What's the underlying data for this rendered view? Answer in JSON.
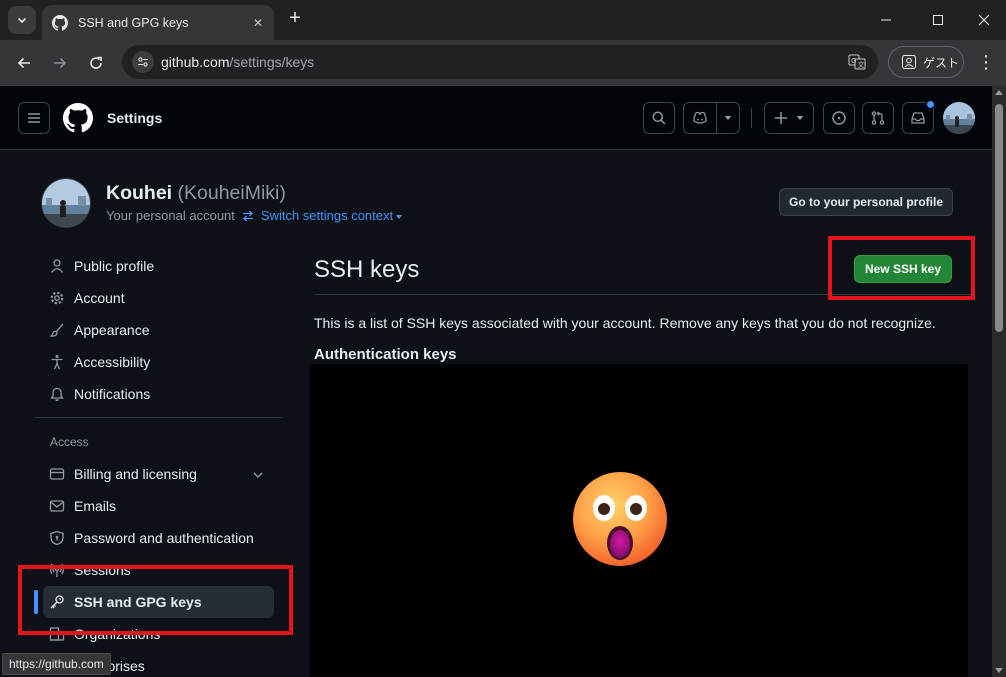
{
  "browser": {
    "tab_title": "SSH and GPG keys",
    "url_host": "github.com",
    "url_path": "/settings/keys",
    "profile_label": "ゲスト",
    "status_url": "https://github.com",
    "icons": [
      "tab-search-icon",
      "github-favicon-icon",
      "close-icon",
      "plus-icon",
      "minimize-icon",
      "maximize-icon",
      "window-close-icon",
      "back-icon",
      "forward-icon",
      "reload-icon",
      "site-info-icon",
      "translate-icon",
      "person-icon",
      "kebab-menu-icon"
    ]
  },
  "header": {
    "context": "Settings",
    "icons": [
      "hamburger-icon",
      "github-logo-icon",
      "search-icon",
      "copilot-icon",
      "caret-down-icon",
      "plus-icon",
      "issue-opened-icon",
      "pull-request-icon",
      "inbox-icon"
    ]
  },
  "account": {
    "name": "Kouhei",
    "login": "(KouheiMiki)",
    "subtitle": "Your personal account",
    "switch_label": "Switch settings context",
    "profile_button": "Go to your personal profile"
  },
  "sidebar": {
    "items": [
      {
        "label": "Public profile",
        "icon": "person-icon"
      },
      {
        "label": "Account",
        "icon": "gear-icon"
      },
      {
        "label": "Appearance",
        "icon": "paintbrush-icon"
      },
      {
        "label": "Accessibility",
        "icon": "accessibility-icon"
      },
      {
        "label": "Notifications",
        "icon": "bell-icon"
      }
    ],
    "access_heading": "Access",
    "access_items": [
      {
        "label": "Billing and licensing",
        "icon": "credit-card-icon"
      },
      {
        "label": "Emails",
        "icon": "mail-icon"
      },
      {
        "label": "Password and authentication",
        "icon": "shield-lock-icon"
      },
      {
        "label": "Sessions",
        "icon": "broadcast-icon"
      },
      {
        "label": "SSH and GPG keys",
        "icon": "key-icon",
        "active": true
      },
      {
        "label": "Organizations",
        "icon": "organization-icon"
      },
      {
        "label": "Enterprises",
        "icon": "globe-icon"
      }
    ]
  },
  "main": {
    "title": "SSH keys",
    "new_button": "New SSH key",
    "description": "This is a list of SSH keys associated with your account. Remove any keys that you do not recognize.",
    "auth_heading": "Authentication keys",
    "overlay_icon": "astonished-face-icon"
  },
  "colors": {
    "page_bg": "#0d1117",
    "header_bg": "#010409",
    "accent": "#4493f8",
    "button_green": "#238636",
    "highlight_red": "#e3141b"
  }
}
